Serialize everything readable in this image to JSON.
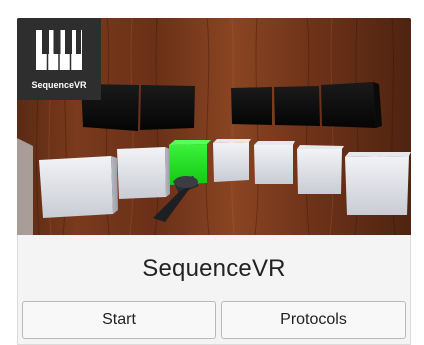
{
  "app": {
    "name": "SequenceVR",
    "logo_label": "SequenceVR",
    "logo_icon": "piano-keys-icon"
  },
  "preview": {
    "scene": "vr-room-with-cubes",
    "highlight_color": "#22dd22"
  },
  "actions": {
    "start_label": "Start",
    "protocols_label": "Protocols"
  }
}
